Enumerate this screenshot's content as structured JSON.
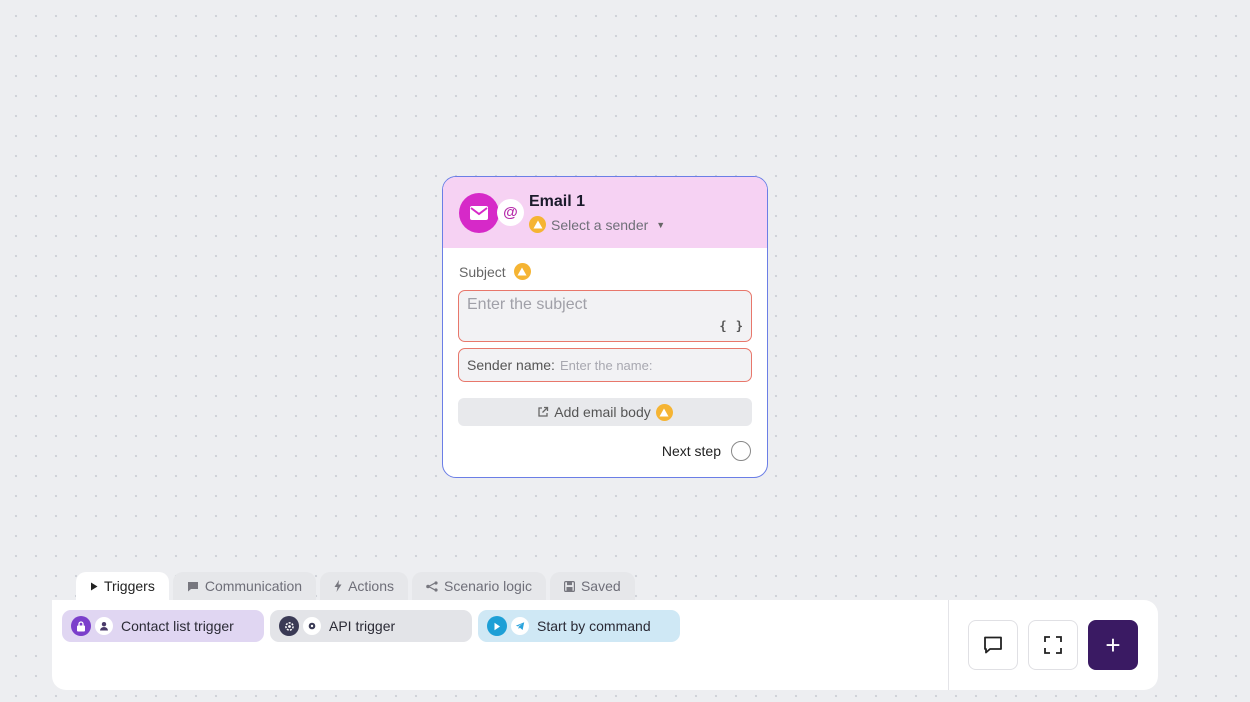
{
  "node": {
    "title": "Email 1",
    "sender_select": "Select a sender",
    "subject_label": "Subject",
    "subject_placeholder": "Enter the subject",
    "variable_icon": "{ }",
    "sender_name_label": "Sender name:",
    "sender_name_placeholder": "Enter the name:",
    "add_body_label": "Add email body",
    "next_step_label": "Next step",
    "icons": [
      "envelope-icon",
      "at-icon",
      "warning-icon",
      "chevron-down-icon",
      "external-link-icon"
    ],
    "colors": {
      "accent": "#d629c8",
      "header_bg": "#f6d2f3",
      "border": "#6b7ee6",
      "warning": "#f5b433",
      "error_border": "#e8776b"
    }
  },
  "tabs": [
    {
      "label": "Triggers",
      "icon": "play-icon",
      "active": true
    },
    {
      "label": "Communication",
      "icon": "chat-icon",
      "active": false
    },
    {
      "label": "Actions",
      "icon": "lightning-icon",
      "active": false
    },
    {
      "label": "Scenario logic",
      "icon": "branch-icon",
      "active": false
    },
    {
      "label": "Saved",
      "icon": "save-icon",
      "active": false
    }
  ],
  "triggers": [
    {
      "label": "Contact list trigger",
      "icons": [
        "lock-icon",
        "user-icon"
      ],
      "color": "#e0d6f2"
    },
    {
      "label": "API trigger",
      "icons": [
        "gear-icon",
        "dot-icon"
      ],
      "color": "#e3e4e8"
    },
    {
      "label": "Start by command",
      "icons": [
        "play-icon",
        "telegram-icon"
      ],
      "color": "#cfe8f5"
    }
  ],
  "toolbar": {
    "buttons": [
      "comment-icon",
      "fullscreen-icon",
      "plus-icon"
    ],
    "add_label": "+",
    "add_color": "#3a1a63"
  }
}
